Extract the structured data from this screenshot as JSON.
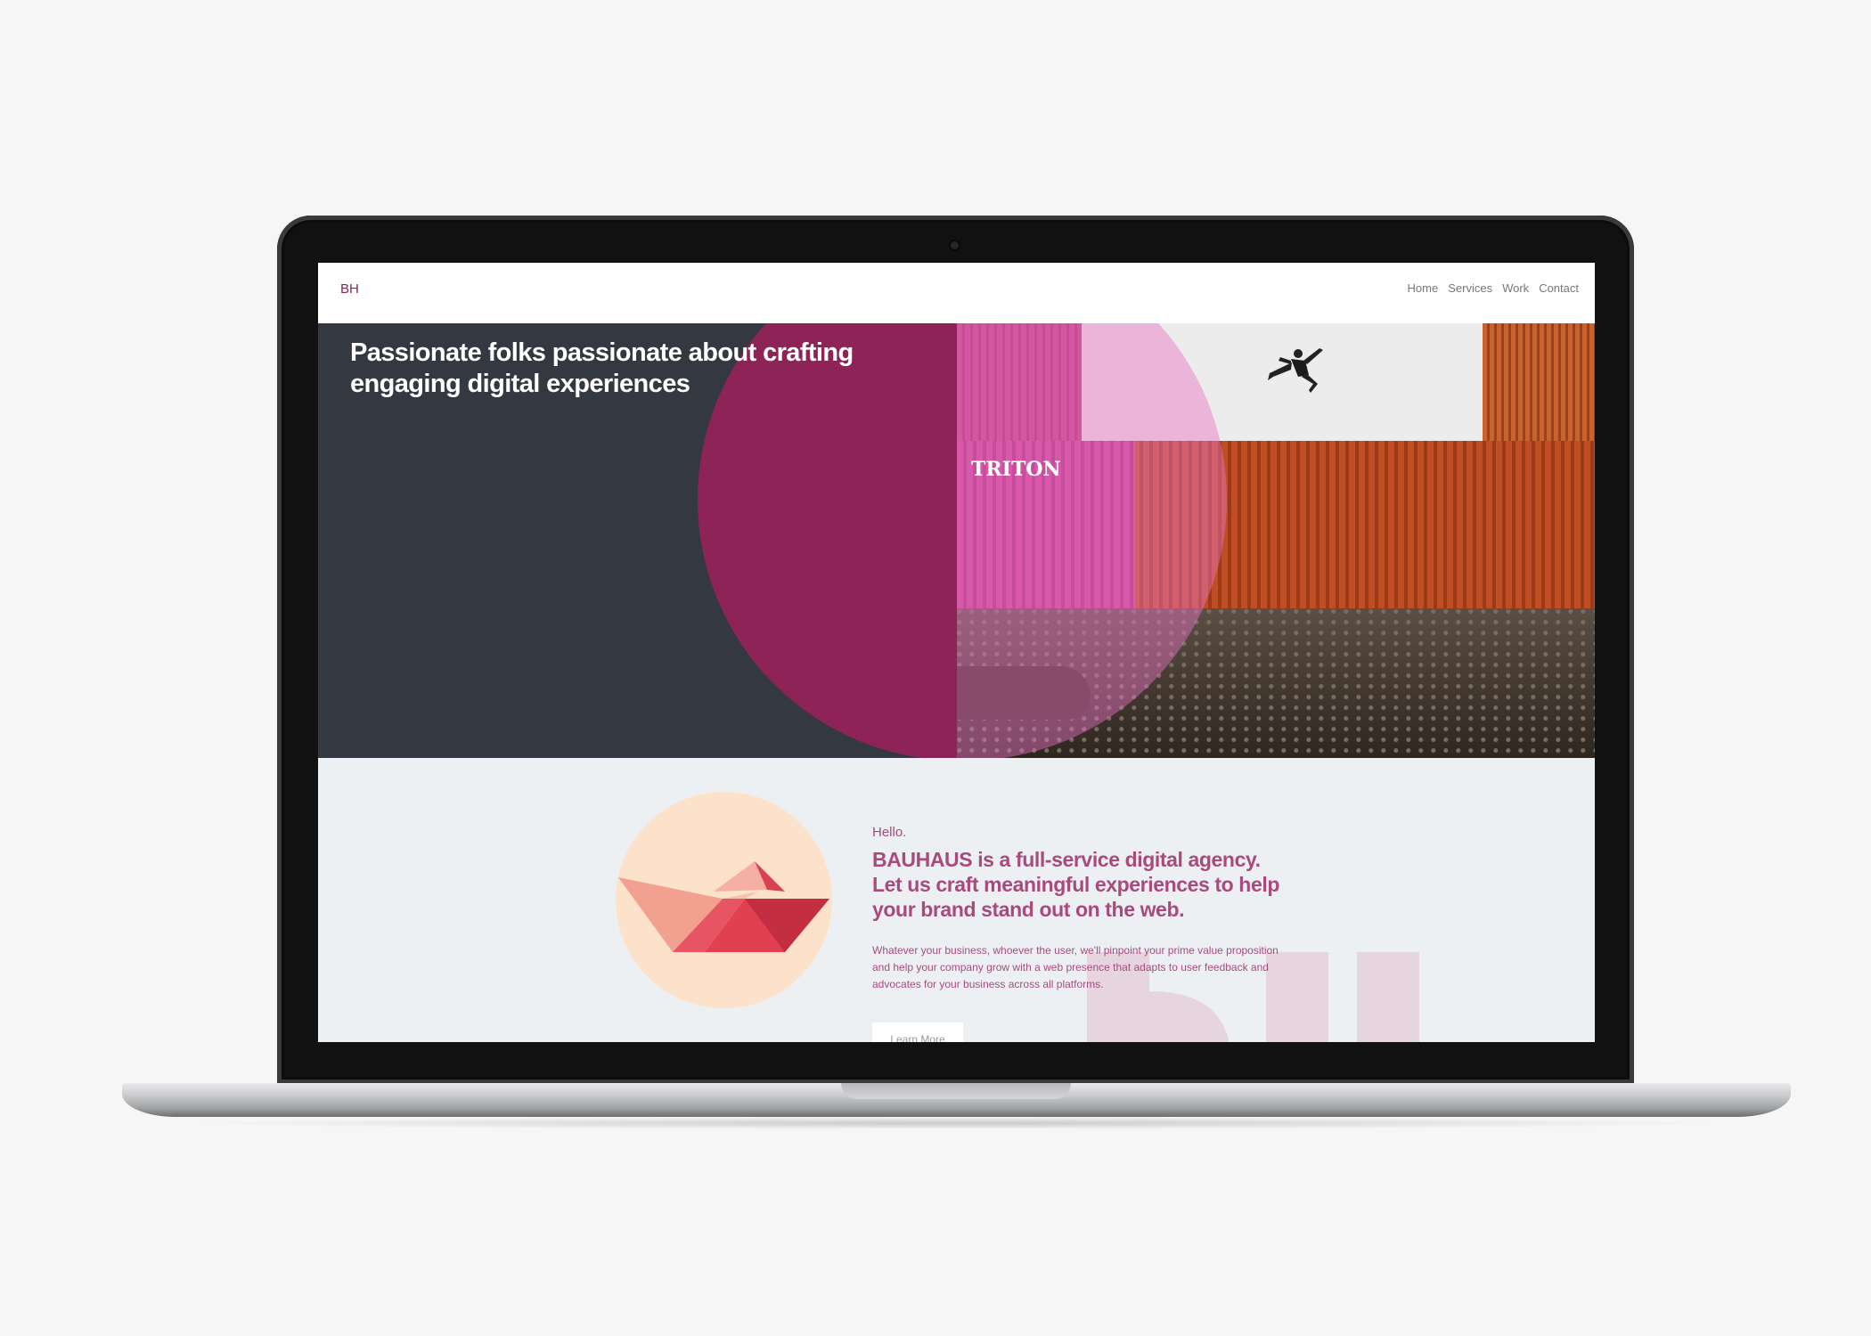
{
  "nav": {
    "logo": "BH",
    "items": [
      "Home",
      "Services",
      "Work",
      "Contact"
    ]
  },
  "hero": {
    "title_line1": "Passionate folks passionate about crafting",
    "title_line2": "engaging digital experiences",
    "container_text": "TRITON"
  },
  "about": {
    "greeting": "Hello.",
    "heading": "BAUHAUS is a full-service digital agency. Let us craft meaningful experiences to help your brand stand out on the web.",
    "body": "Whatever your business, whoever the user, we'll pinpoint your prime value proposition and help your company grow with a web presence that adapts to user feedback and advocates for your business across all platforms.",
    "button": "Learn More"
  },
  "colors": {
    "brand": "#8e2358",
    "hero_bg": "#343841",
    "about_bg": "#edf0f3",
    "accent_text": "#a84b7c"
  }
}
